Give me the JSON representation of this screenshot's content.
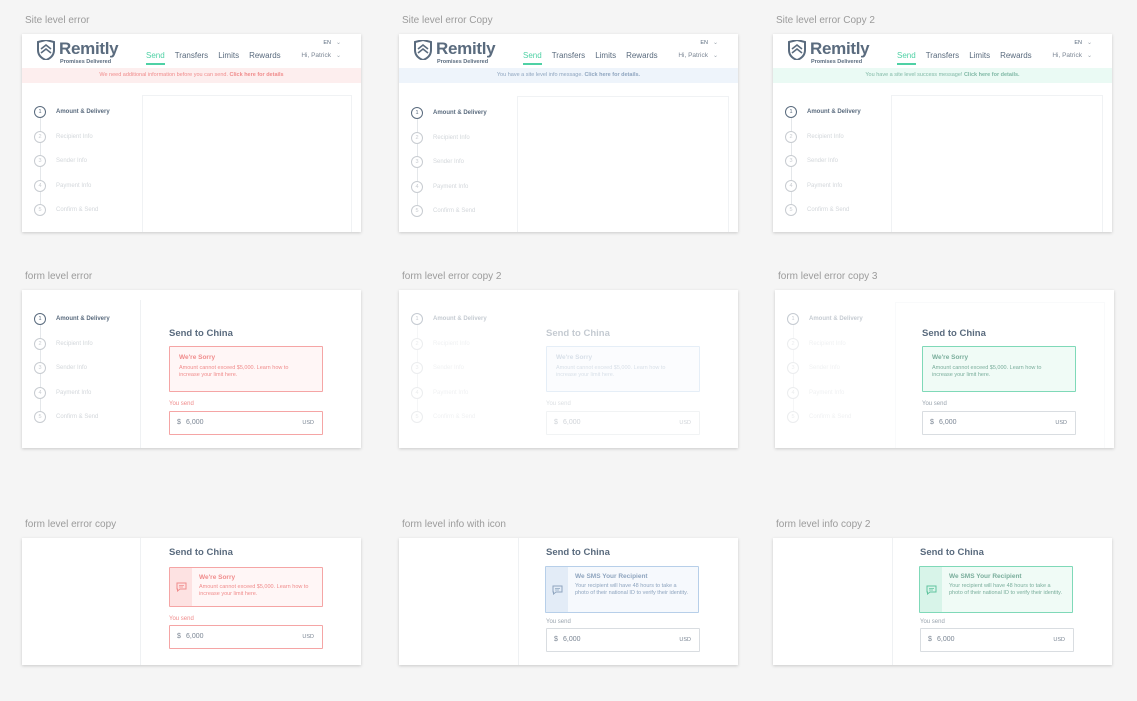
{
  "brand": {
    "name": "Remitly",
    "tagline": "Promises Delivered"
  },
  "nav": [
    "Send",
    "Transfers",
    "Limits",
    "Rewards"
  ],
  "lang": "EN",
  "user": "Hi, Patrick",
  "steps": [
    "Amount & Delivery",
    "Recipient Info",
    "Sender Info",
    "Payment Info",
    "Confirm & Send"
  ],
  "artboards": {
    "site_error": {
      "title": "Site level error",
      "banner_text": "We need additional information before you can send.",
      "banner_link": "Click here for details"
    },
    "site_info": {
      "title": "Site level error Copy",
      "banner_text": "You have a site level info message.",
      "banner_link": "Click here for details."
    },
    "site_success": {
      "title": "Site level error Copy 2",
      "banner_text": "You have a site level success message!",
      "banner_link": "Click here for details."
    },
    "form_error": {
      "title": "form level error"
    },
    "form_info": {
      "title": "form level error copy 2"
    },
    "form_success": {
      "title": "form level error copy 3"
    },
    "form_error_icon": {
      "title": "form level error copy"
    },
    "form_info_icon": {
      "title": "form level info with icon"
    },
    "form_success_icon": {
      "title": "form level info copy 2"
    }
  },
  "form": {
    "title": "Send to China",
    "sorry_title": "We're Sorry",
    "sorry_text": "Amount cannot exceed $5,000. Learn how to increase your limit here.",
    "sorry_text_short": "Amount cannot exceed $5,000. Learn how to increase your limit here.",
    "sms_title": "We SMS Your Recipient",
    "sms_text": "Your recipient will have 48 hours to take a photo of their national ID to verify their identity.",
    "you_send": "You send",
    "currency_symbol": "$",
    "amount": "6,000",
    "currency": "USD"
  },
  "colors": {
    "brand": "#5a6b7e",
    "accent": "#4fd1a5",
    "error": "#f08c8c",
    "info": "#8fa5bf",
    "success": "#7fd9b8"
  }
}
